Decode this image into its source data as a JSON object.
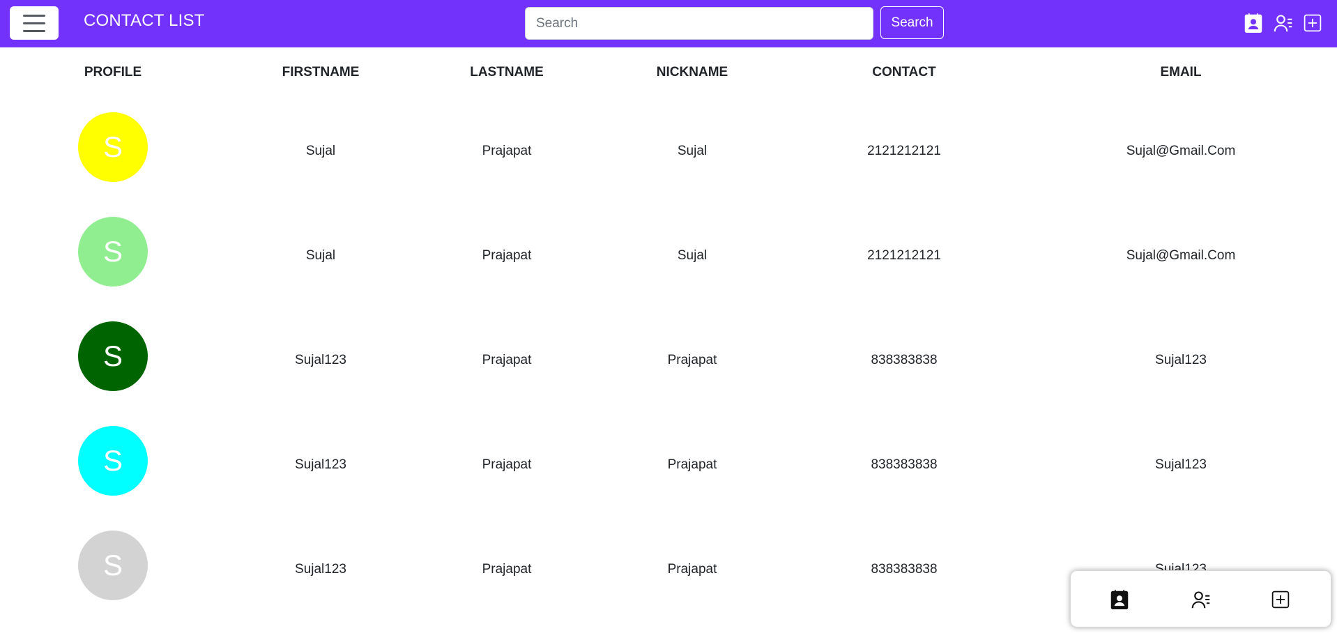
{
  "navbar": {
    "brand": "CONTACT LIST",
    "search_placeholder": "Search",
    "search_value": "",
    "search_button": "Search",
    "background_color": "#7332fb",
    "icons": [
      "contact-card-icon",
      "person-list-icon",
      "plus-square-icon"
    ]
  },
  "table": {
    "headers": [
      "PROFILE",
      "FIRSTNAME",
      "LASTNAME",
      "NICKNAME",
      "CONTACT",
      "EMAIL"
    ],
    "rows": [
      {
        "initial": "S",
        "color": "#ffff00",
        "firstname": "Sujal",
        "lastname": "Prajapat",
        "nickname": "Sujal",
        "contact": "2121212121",
        "email": "Sujal@Gmail.Com"
      },
      {
        "initial": "S",
        "color": "#90ee90",
        "firstname": "Sujal",
        "lastname": "Prajapat",
        "nickname": "Sujal",
        "contact": "2121212121",
        "email": "Sujal@Gmail.Com"
      },
      {
        "initial": "S",
        "color": "#006400",
        "firstname": "Sujal123",
        "lastname": "Prajapat",
        "nickname": "Prajapat",
        "contact": "838383838",
        "email": "Sujal123"
      },
      {
        "initial": "S",
        "color": "#00ffff",
        "firstname": "Sujal123",
        "lastname": "Prajapat",
        "nickname": "Prajapat",
        "contact": "838383838",
        "email": "Sujal123"
      },
      {
        "initial": "S",
        "color": "#d3d3d3",
        "firstname": "Sujal123",
        "lastname": "Prajapat",
        "nickname": "Prajapat",
        "contact": "838383838",
        "email": "Sujal123"
      }
    ]
  },
  "bottom_bar": {
    "icons": [
      "contact-card-icon",
      "person-list-icon",
      "plus-square-icon"
    ]
  }
}
